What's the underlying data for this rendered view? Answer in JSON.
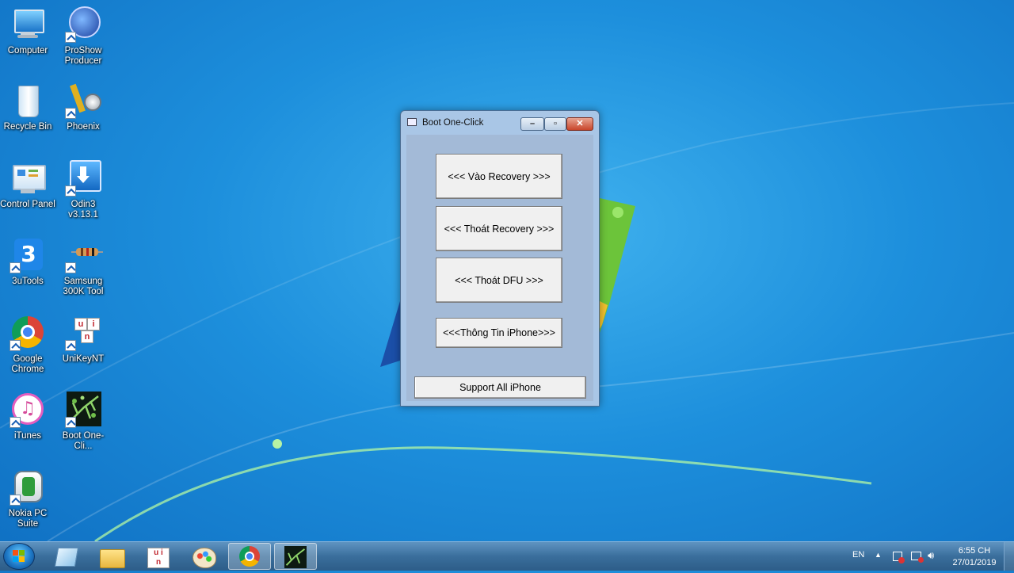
{
  "desktop": {
    "icons": [
      {
        "label": "Computer"
      },
      {
        "label": "ProShow Producer"
      },
      {
        "label": "Recycle Bin"
      },
      {
        "label": "Phoenix"
      },
      {
        "label": "Control Panel"
      },
      {
        "label": "Odin3 v3.13.1"
      },
      {
        "label": "3uTools"
      },
      {
        "label": "Samsung 300K Tool"
      },
      {
        "label": "Google Chrome"
      },
      {
        "label": "UniKeyNT"
      },
      {
        "label": "iTunes"
      },
      {
        "label": "Boot One-Cli..."
      },
      {
        "label": "Nokia PC Suite"
      }
    ]
  },
  "window": {
    "title": "Boot One-Click",
    "buttons": {
      "vao_recovery": "<<< Vào Recovery >>>",
      "thoat_recovery": "<<< Thoát Recovery >>>",
      "thoat_dfu": "<<< Thoát DFU >>>",
      "thong_tin": "<<<Thông Tin iPhone>>>",
      "support": "Support All iPhone"
    }
  },
  "taskbar": {
    "language": "EN",
    "time": "6:55 CH",
    "date": "27/01/2019"
  },
  "colors": {
    "window_frame": "#a9c6e6",
    "client_bg": "#a3bad7",
    "taskbar": "#3a6e9c",
    "desktop": "#1d8fdc"
  }
}
